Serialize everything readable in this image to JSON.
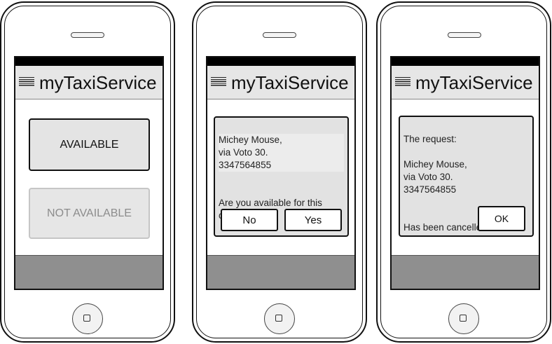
{
  "app": {
    "title": "myTaxiService"
  },
  "screen1": {
    "available_label": "AVAILABLE",
    "not_available_label": "NOT AVAILABLE"
  },
  "screen2": {
    "request_lines": "Michey Mouse,\nvia Voto 30.\n3347564855",
    "question": "Are you available for this call?",
    "no_label": "No",
    "yes_label": "Yes"
  },
  "screen3": {
    "heading": "The request:",
    "request_lines": "Michey Mouse,\nvia Voto 30.\n3347564855",
    "status": "Has been cancelled.",
    "ok_label": "OK"
  },
  "colors": {
    "status_bar": "#000000",
    "app_bar": "#e6e6e6",
    "bottom_bar": "#8f8f8f",
    "disabled_text": "#8c8c8c"
  },
  "icons": {
    "menu": "hamburger-menu-icon",
    "home": "home-button-icon"
  }
}
